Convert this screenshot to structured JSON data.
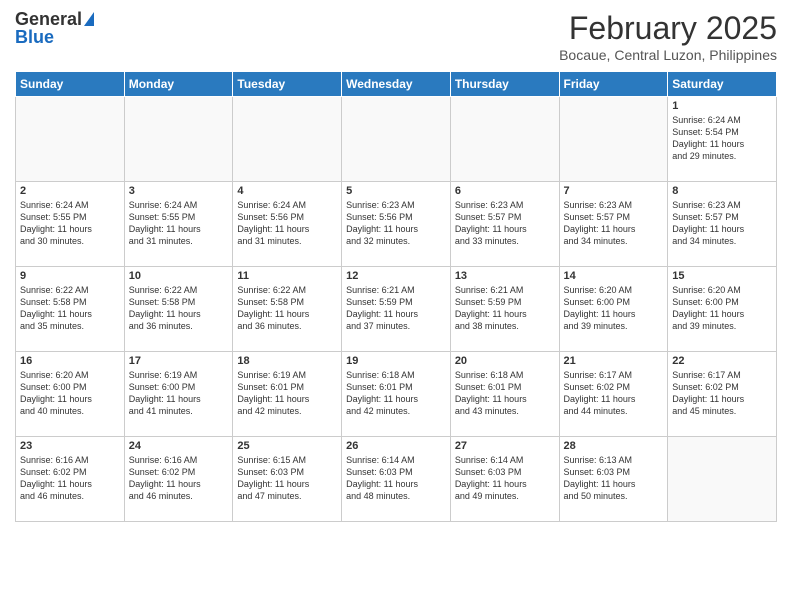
{
  "header": {
    "logo_general": "General",
    "logo_blue": "Blue",
    "month": "February 2025",
    "location": "Bocaue, Central Luzon, Philippines"
  },
  "weekdays": [
    "Sunday",
    "Monday",
    "Tuesday",
    "Wednesday",
    "Thursday",
    "Friday",
    "Saturday"
  ],
  "weeks": [
    [
      {
        "day": "",
        "info": ""
      },
      {
        "day": "",
        "info": ""
      },
      {
        "day": "",
        "info": ""
      },
      {
        "day": "",
        "info": ""
      },
      {
        "day": "",
        "info": ""
      },
      {
        "day": "",
        "info": ""
      },
      {
        "day": "1",
        "info": "Sunrise: 6:24 AM\nSunset: 5:54 PM\nDaylight: 11 hours\nand 29 minutes."
      }
    ],
    [
      {
        "day": "2",
        "info": "Sunrise: 6:24 AM\nSunset: 5:55 PM\nDaylight: 11 hours\nand 30 minutes."
      },
      {
        "day": "3",
        "info": "Sunrise: 6:24 AM\nSunset: 5:55 PM\nDaylight: 11 hours\nand 31 minutes."
      },
      {
        "day": "4",
        "info": "Sunrise: 6:24 AM\nSunset: 5:56 PM\nDaylight: 11 hours\nand 31 minutes."
      },
      {
        "day": "5",
        "info": "Sunrise: 6:23 AM\nSunset: 5:56 PM\nDaylight: 11 hours\nand 32 minutes."
      },
      {
        "day": "6",
        "info": "Sunrise: 6:23 AM\nSunset: 5:57 PM\nDaylight: 11 hours\nand 33 minutes."
      },
      {
        "day": "7",
        "info": "Sunrise: 6:23 AM\nSunset: 5:57 PM\nDaylight: 11 hours\nand 34 minutes."
      },
      {
        "day": "8",
        "info": "Sunrise: 6:23 AM\nSunset: 5:57 PM\nDaylight: 11 hours\nand 34 minutes."
      }
    ],
    [
      {
        "day": "9",
        "info": "Sunrise: 6:22 AM\nSunset: 5:58 PM\nDaylight: 11 hours\nand 35 minutes."
      },
      {
        "day": "10",
        "info": "Sunrise: 6:22 AM\nSunset: 5:58 PM\nDaylight: 11 hours\nand 36 minutes."
      },
      {
        "day": "11",
        "info": "Sunrise: 6:22 AM\nSunset: 5:58 PM\nDaylight: 11 hours\nand 36 minutes."
      },
      {
        "day": "12",
        "info": "Sunrise: 6:21 AM\nSunset: 5:59 PM\nDaylight: 11 hours\nand 37 minutes."
      },
      {
        "day": "13",
        "info": "Sunrise: 6:21 AM\nSunset: 5:59 PM\nDaylight: 11 hours\nand 38 minutes."
      },
      {
        "day": "14",
        "info": "Sunrise: 6:20 AM\nSunset: 6:00 PM\nDaylight: 11 hours\nand 39 minutes."
      },
      {
        "day": "15",
        "info": "Sunrise: 6:20 AM\nSunset: 6:00 PM\nDaylight: 11 hours\nand 39 minutes."
      }
    ],
    [
      {
        "day": "16",
        "info": "Sunrise: 6:20 AM\nSunset: 6:00 PM\nDaylight: 11 hours\nand 40 minutes."
      },
      {
        "day": "17",
        "info": "Sunrise: 6:19 AM\nSunset: 6:00 PM\nDaylight: 11 hours\nand 41 minutes."
      },
      {
        "day": "18",
        "info": "Sunrise: 6:19 AM\nSunset: 6:01 PM\nDaylight: 11 hours\nand 42 minutes."
      },
      {
        "day": "19",
        "info": "Sunrise: 6:18 AM\nSunset: 6:01 PM\nDaylight: 11 hours\nand 42 minutes."
      },
      {
        "day": "20",
        "info": "Sunrise: 6:18 AM\nSunset: 6:01 PM\nDaylight: 11 hours\nand 43 minutes."
      },
      {
        "day": "21",
        "info": "Sunrise: 6:17 AM\nSunset: 6:02 PM\nDaylight: 11 hours\nand 44 minutes."
      },
      {
        "day": "22",
        "info": "Sunrise: 6:17 AM\nSunset: 6:02 PM\nDaylight: 11 hours\nand 45 minutes."
      }
    ],
    [
      {
        "day": "23",
        "info": "Sunrise: 6:16 AM\nSunset: 6:02 PM\nDaylight: 11 hours\nand 46 minutes."
      },
      {
        "day": "24",
        "info": "Sunrise: 6:16 AM\nSunset: 6:02 PM\nDaylight: 11 hours\nand 46 minutes."
      },
      {
        "day": "25",
        "info": "Sunrise: 6:15 AM\nSunset: 6:03 PM\nDaylight: 11 hours\nand 47 minutes."
      },
      {
        "day": "26",
        "info": "Sunrise: 6:14 AM\nSunset: 6:03 PM\nDaylight: 11 hours\nand 48 minutes."
      },
      {
        "day": "27",
        "info": "Sunrise: 6:14 AM\nSunset: 6:03 PM\nDaylight: 11 hours\nand 49 minutes."
      },
      {
        "day": "28",
        "info": "Sunrise: 6:13 AM\nSunset: 6:03 PM\nDaylight: 11 hours\nand 50 minutes."
      },
      {
        "day": "",
        "info": ""
      }
    ]
  ]
}
